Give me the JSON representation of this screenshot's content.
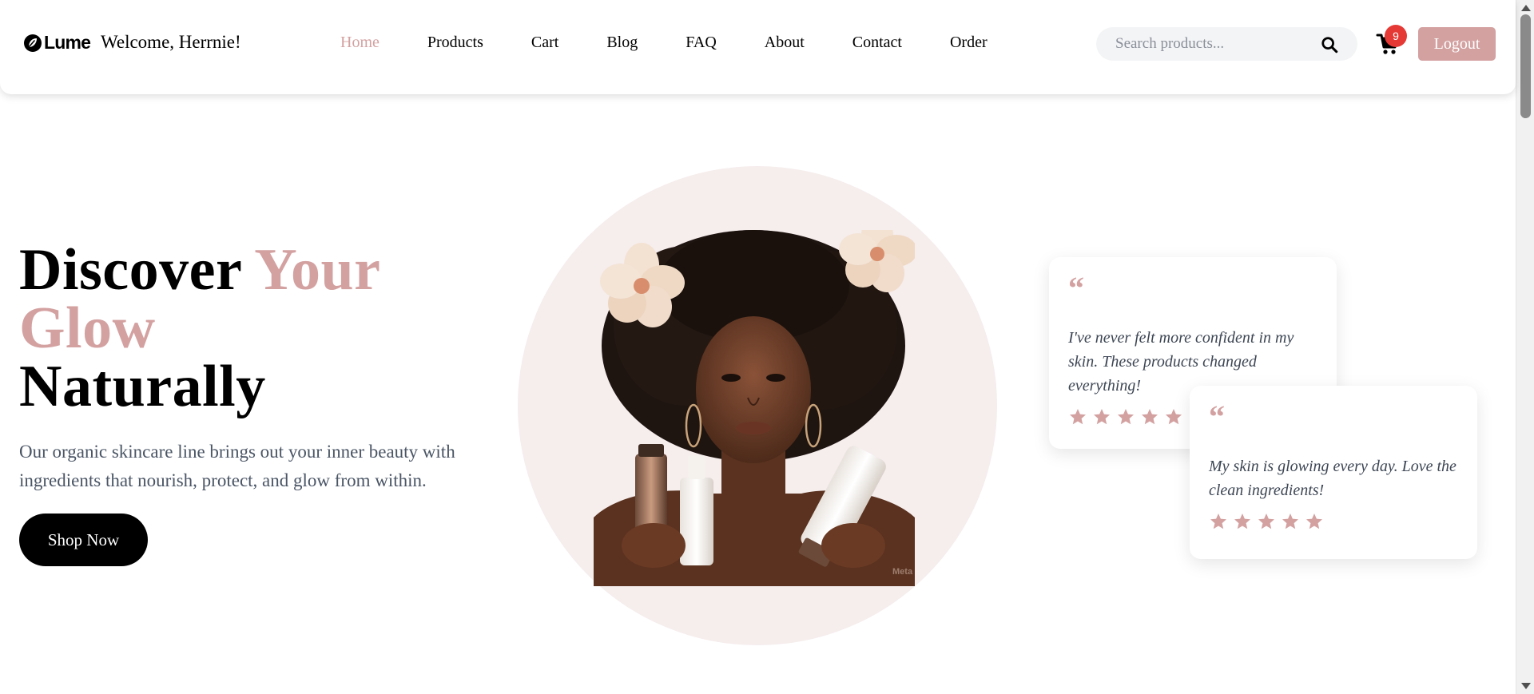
{
  "header": {
    "brand": "Lume",
    "welcome": "Welcome, Herrnie!",
    "nav": [
      {
        "label": "Home",
        "active": true
      },
      {
        "label": "Products",
        "active": false
      },
      {
        "label": "Cart",
        "active": false
      },
      {
        "label": "Blog",
        "active": false
      },
      {
        "label": "FAQ",
        "active": false
      },
      {
        "label": "About",
        "active": false
      },
      {
        "label": "Contact",
        "active": false
      },
      {
        "label": "Order",
        "active": false
      }
    ],
    "search": {
      "placeholder": "Search products...",
      "value": "",
      "icon": "search-icon"
    },
    "cart": {
      "icon": "cart-icon",
      "count": "9"
    },
    "logout_label": "Logout"
  },
  "hero": {
    "title_line1_a": "Discover ",
    "title_line1_b": "Your",
    "title_line2": "Glow",
    "title_line3": "Naturally",
    "description": "Our organic skincare line brings out your inner beauty with ingredients that nourish, protect, and glow from within.",
    "cta_label": "Shop Now",
    "image_watermark": "Meta"
  },
  "testimonials": [
    {
      "quote_mark": "“",
      "text": "I've never felt more confident in my skin. These products changed everything!",
      "rating": 5
    },
    {
      "quote_mark": "“",
      "text": "My skin is glowing every day. Love the clean ingredients!",
      "rating": 5
    }
  ],
  "colors": {
    "accent": "#d4a1a1",
    "badge": "#e53935",
    "text_muted": "#4a5565",
    "circle_bg": "#f6eded"
  }
}
